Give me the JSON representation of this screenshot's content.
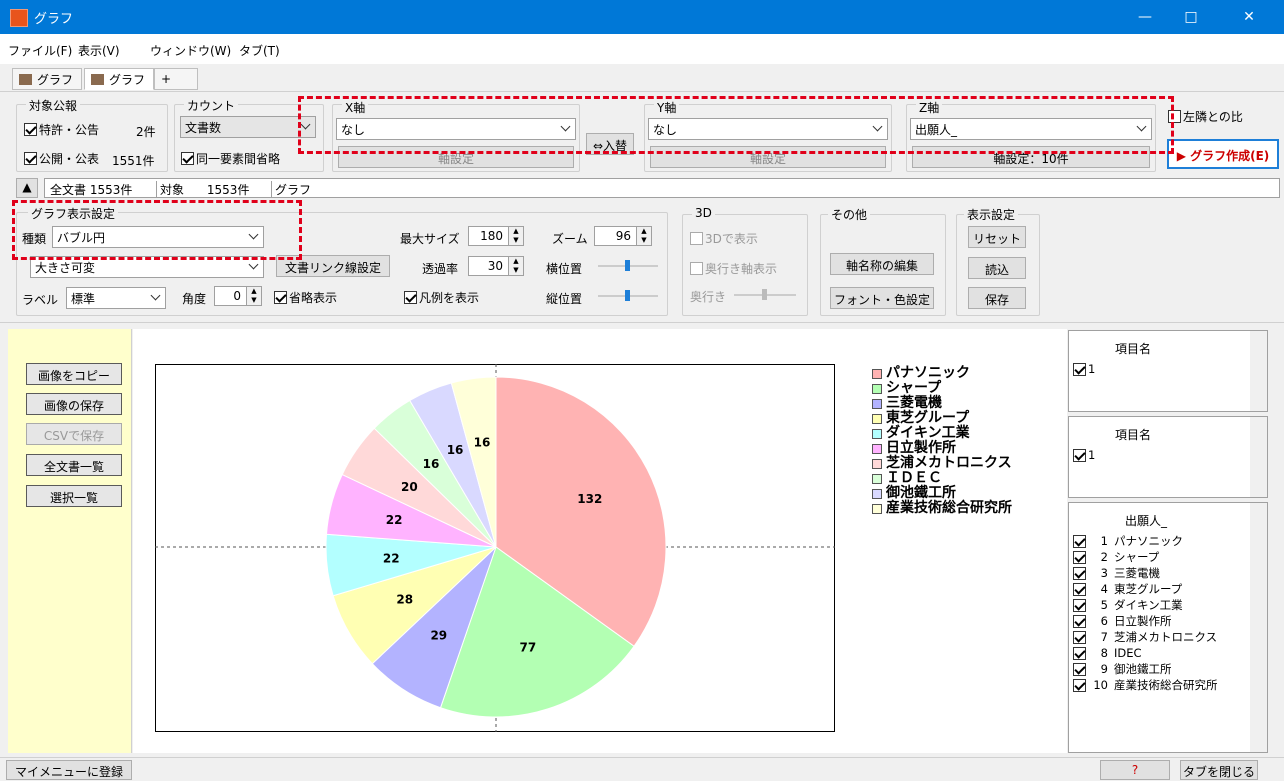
{
  "window": {
    "title": "グラフ"
  },
  "menu": [
    "ファイル(F)",
    "表示(V)",
    "ウィンドウ(W)",
    "タブ(T)"
  ],
  "tabs": [
    {
      "label": "グラフ",
      "active": false
    },
    {
      "label": "グラフ",
      "active": true
    },
    {
      "label": "+"
    }
  ],
  "target": {
    "title": "対象公報",
    "row1_label": "特許・公告",
    "row1_count": "2件",
    "row2_label": "公開・公表",
    "row2_count": "1551件"
  },
  "count": {
    "title": "カウント",
    "value": "文書数",
    "omit_label": "同一要素間省略"
  },
  "xaxis": {
    "title": "X軸",
    "value": "なし",
    "settings": "軸設定"
  },
  "swap": "⇔入替",
  "yaxis": {
    "title": "Y軸",
    "value": "なし",
    "settings": "軸設定"
  },
  "zaxis": {
    "title": "Z軸",
    "value": "出願人_",
    "settings": "軸設定：10件"
  },
  "neighbor_ratio": "左隣との比",
  "create_graph": "グラフ作成(E)",
  "summary": {
    "toggle": "▲",
    "all_docs": "全文書",
    "all_count": "1553件",
    "target_label": "対象",
    "target_count": "1553件",
    "name": "グラフ"
  },
  "graph_settings": {
    "title": "グラフ表示設定",
    "type_label": "種類",
    "type_value": "バブル円",
    "size_mode": "大きさ可変",
    "label_label": "ラベル",
    "label_value": "標準",
    "angle_label": "角度",
    "angle_value": "0",
    "abbrev": "省略表示",
    "doc_link": "文書リンク線設定",
    "max_size_label": "最大サイズ",
    "max_size": "180",
    "opacity_label": "透過率",
    "opacity": "30",
    "legend": "凡例を表示",
    "zoom_label": "ズーム",
    "zoom": "96",
    "hpos_label": "横位置",
    "vpos_label": "縦位置"
  },
  "three_d": {
    "title": "3D",
    "show_3d": "3Dで表示",
    "depth_axis": "奥行き軸表示",
    "depth": "奥行き"
  },
  "other": {
    "title": "その他",
    "edit_axis": "軸名称の編集",
    "font_color": "フォント・色設定"
  },
  "display": {
    "title": "表示設定",
    "reset": "リセット",
    "load": "読込",
    "save": "保存"
  },
  "left_buttons": [
    "画像をコピー",
    "画像の保存",
    "CSVで保存",
    "全文書一覧",
    "選択一覧"
  ],
  "colors": {
    "titlebar": "#0078d7",
    "accent_red": "#e0001a",
    "left_panel": "#ffffcc"
  },
  "chart_data": {
    "type": "pie",
    "categories": [
      "パナソニック",
      "シャープ",
      "三菱電機",
      "東芝グループ",
      "ダイキン工業",
      "日立製作所",
      "芝浦メカトロニクス",
      "ＩＤＥＣ",
      "御池鐵工所",
      "産業技術総合研究所"
    ],
    "values": [
      132,
      77,
      29,
      28,
      22,
      22,
      20,
      16,
      16,
      16
    ],
    "colors": [
      "#ffb3b3",
      "#b3ffb3",
      "#b3b3ff",
      "#ffffb3",
      "#b3ffff",
      "#ffb3ff",
      "#ffd9d9",
      "#d9ffd9",
      "#d9d9ff",
      "#ffffd9"
    ],
    "legend_position": "top-right"
  },
  "panels": [
    {
      "header": "項目名",
      "items": [
        {
          "n": "1",
          "label": ""
        }
      ]
    },
    {
      "header": "項目名",
      "items": [
        {
          "n": "1",
          "label": ""
        }
      ]
    },
    {
      "header": "出願人_",
      "items": [
        {
          "n": "1",
          "label": "パナソニック"
        },
        {
          "n": "2",
          "label": "シャープ"
        },
        {
          "n": "3",
          "label": "三菱電機"
        },
        {
          "n": "4",
          "label": "東芝グループ"
        },
        {
          "n": "5",
          "label": "ダイキン工業"
        },
        {
          "n": "6",
          "label": "日立製作所"
        },
        {
          "n": "7",
          "label": "芝浦メカトロニクス"
        },
        {
          "n": "8",
          "label": "IDEC"
        },
        {
          "n": "9",
          "label": "御池鐵工所"
        },
        {
          "n": "10",
          "label": "産業技術総合研究所"
        }
      ]
    }
  ],
  "status": {
    "register": "マイメニューに登録",
    "help": "?",
    "close_tab": "タブを閉じる"
  }
}
